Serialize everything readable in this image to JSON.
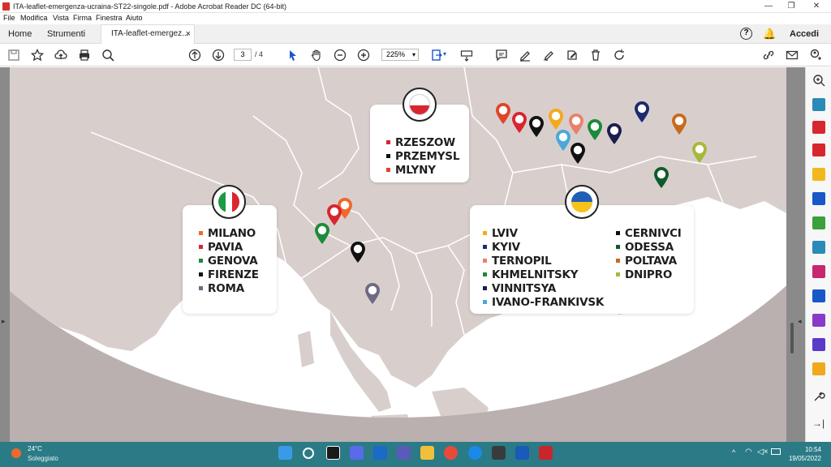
{
  "window": {
    "title": "ITA-leaflet-emergenza-ucraina-ST22-singole.pdf - Adobe Acrobat Reader DC (64-bit)",
    "controls": {
      "minimize": "—",
      "maximize": "❐",
      "close": "✕"
    }
  },
  "menu": [
    "File",
    "Modifica",
    "Vista",
    "Firma",
    "Finestra",
    "Aiuto"
  ],
  "tabs": {
    "home": "Home",
    "tools": "Strumenti",
    "document": "ITA-leaflet-emergez...",
    "close": "×",
    "signin": "Accedi"
  },
  "toolbar": {
    "page_current": "3",
    "page_total": "/ 4",
    "zoom": "225%"
  },
  "map": {
    "colors": {
      "land": "#d8cfcd",
      "sea": "#ffffff",
      "outer": "#b9b0af",
      "border": "#ffffff"
    },
    "italy": {
      "flag_colors": [
        "#1c9a46",
        "#ffffff",
        "#d8262f"
      ],
      "cities": [
        {
          "name": "MILANO",
          "color": "#f0682a"
        },
        {
          "name": "PAVIA",
          "color": "#d8262f"
        },
        {
          "name": "GENOVA",
          "color": "#1c8a3a"
        },
        {
          "name": "FIRENZE",
          "color": "#111111"
        },
        {
          "name": "ROMA",
          "color": "#6f6a84"
        }
      ]
    },
    "poland": {
      "flag_colors": [
        "#ffffff",
        "#d8262f"
      ],
      "cities": [
        {
          "name": "RZESZOW",
          "color": "#d8262f"
        },
        {
          "name": "PRZEMYSL",
          "color": "#111111"
        },
        {
          "name": "MLYNY",
          "color": "#e0442a"
        }
      ]
    },
    "ukraine": {
      "flag_colors": [
        "#1f5fb8",
        "#f6c21c"
      ],
      "cities_left": [
        {
          "name": "LVIV",
          "color": "#f6a81c"
        },
        {
          "name": "KYIV",
          "color": "#1c2a6e"
        },
        {
          "name": "TERNOPIL",
          "color": "#e8826a"
        },
        {
          "name": "KHMELNITSKY",
          "color": "#1c8a3a"
        },
        {
          "name": "VINNITSYA",
          "color": "#1c1c4e"
        },
        {
          "name": "IVANO-FRANKIVSK",
          "color": "#4aa8d8"
        }
      ],
      "cities_right": [
        {
          "name": "CERNIVCI",
          "color": "#111111"
        },
        {
          "name": "ODESSA",
          "color": "#0f5a2a"
        },
        {
          "name": "POLTAVA",
          "color": "#c86a1c"
        },
        {
          "name": "DNIPRO",
          "color": "#a8b83a"
        }
      ]
    }
  },
  "taskbar": {
    "temperature": "24°C",
    "weather": "Soleggiato",
    "time": "10:54",
    "date": "19/05/2022"
  }
}
